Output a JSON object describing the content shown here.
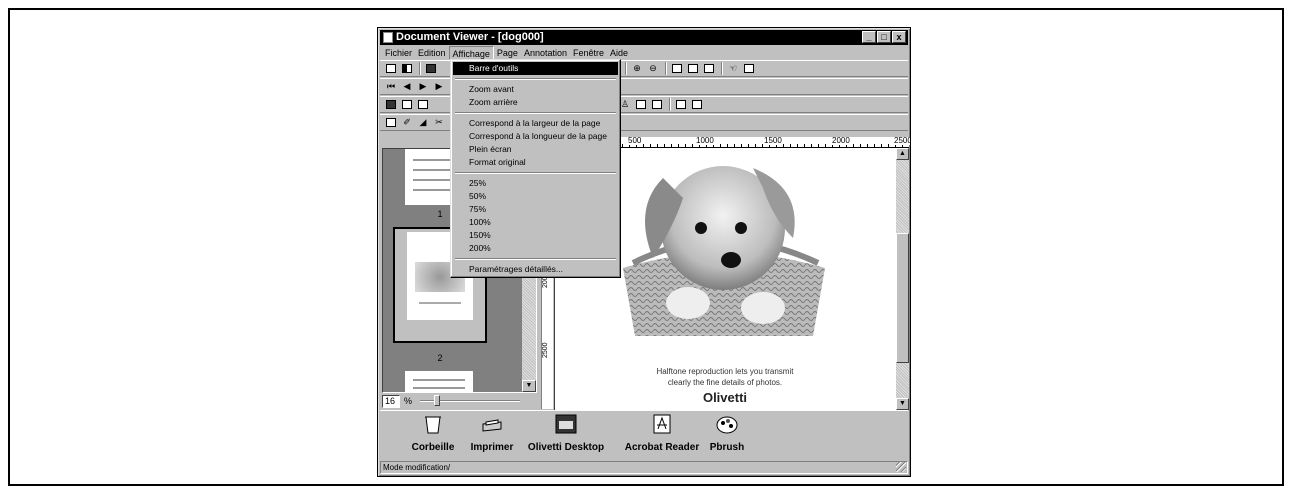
{
  "window": {
    "title": "Document Viewer - [dog000]",
    "controls": [
      "_",
      "□",
      "x"
    ]
  },
  "menubar": {
    "items": [
      "Fichier",
      "Edition",
      "Affichage",
      "Page",
      "Annotation",
      "Fenêtre",
      "Aide"
    ],
    "open": "Affichage"
  },
  "view_menu": {
    "group1": [
      "Barre d'outils"
    ],
    "group2": [
      "Zoom avant",
      "Zoom arrière"
    ],
    "group3": [
      "Correspond à la largeur de la page",
      "Correspond à la longueur de la page",
      "Plein écran",
      "Format original"
    ],
    "group4": [
      "25%",
      "50%",
      "75%",
      "100%",
      "150%",
      "200%"
    ],
    "group5": [
      "Paramétrages détaillés..."
    ],
    "highlighted": "Barre d'outils"
  },
  "thumbnails": {
    "pages": [
      "1",
      "2"
    ],
    "selected": "2"
  },
  "zoom": {
    "value": "16",
    "unit": "%",
    "slider_fraction": 0.15
  },
  "ruler": {
    "h_ticks": [
      "500",
      "1000",
      "1500",
      "2000",
      "2500"
    ],
    "v_ticks": [
      "2000",
      "2500"
    ]
  },
  "document": {
    "caption_line1": "Halftone reproduction lets you transmit",
    "caption_line2": "clearly the fine details of photos.",
    "brand": "Olivetti"
  },
  "taskbar": {
    "items": [
      "Corbeille",
      "Imprimer",
      "Olivetti Desktop",
      "Acrobat Reader",
      "Pbrush"
    ]
  },
  "status": {
    "text": "Mode modification/"
  },
  "icons": [
    "open-icon",
    "save-icon",
    "print-icon",
    "first-page-icon",
    "prev-page-icon",
    "next-page-icon",
    "zoom-in-icon",
    "zoom-out-icon",
    "hand-icon",
    "trash-icon",
    "printer-icon",
    "desktop-icon",
    "acrobat-icon",
    "palette-icon"
  ]
}
